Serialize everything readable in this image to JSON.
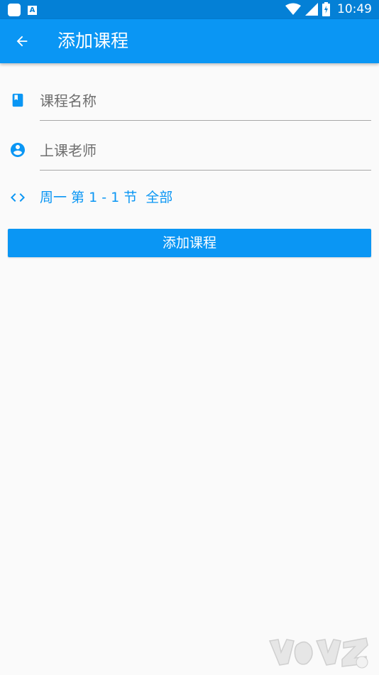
{
  "status_bar": {
    "time": "10:49",
    "notification_letter": "A"
  },
  "app_bar": {
    "title": "添加课程",
    "back_icon": "arrow-left-icon"
  },
  "form": {
    "course_name": {
      "placeholder": "课程名称",
      "icon": "book-icon"
    },
    "teacher": {
      "placeholder": "上课老师",
      "icon": "account-circle-icon"
    },
    "schedule": {
      "text": "周一 第 1 - 1 节  全部",
      "icon": "code-brackets-icon"
    }
  },
  "actions": {
    "add_label": "添加课程"
  },
  "colors": {
    "primary": "#0a96f4",
    "primary_dark": "#0480d6",
    "background": "#fafafa"
  }
}
